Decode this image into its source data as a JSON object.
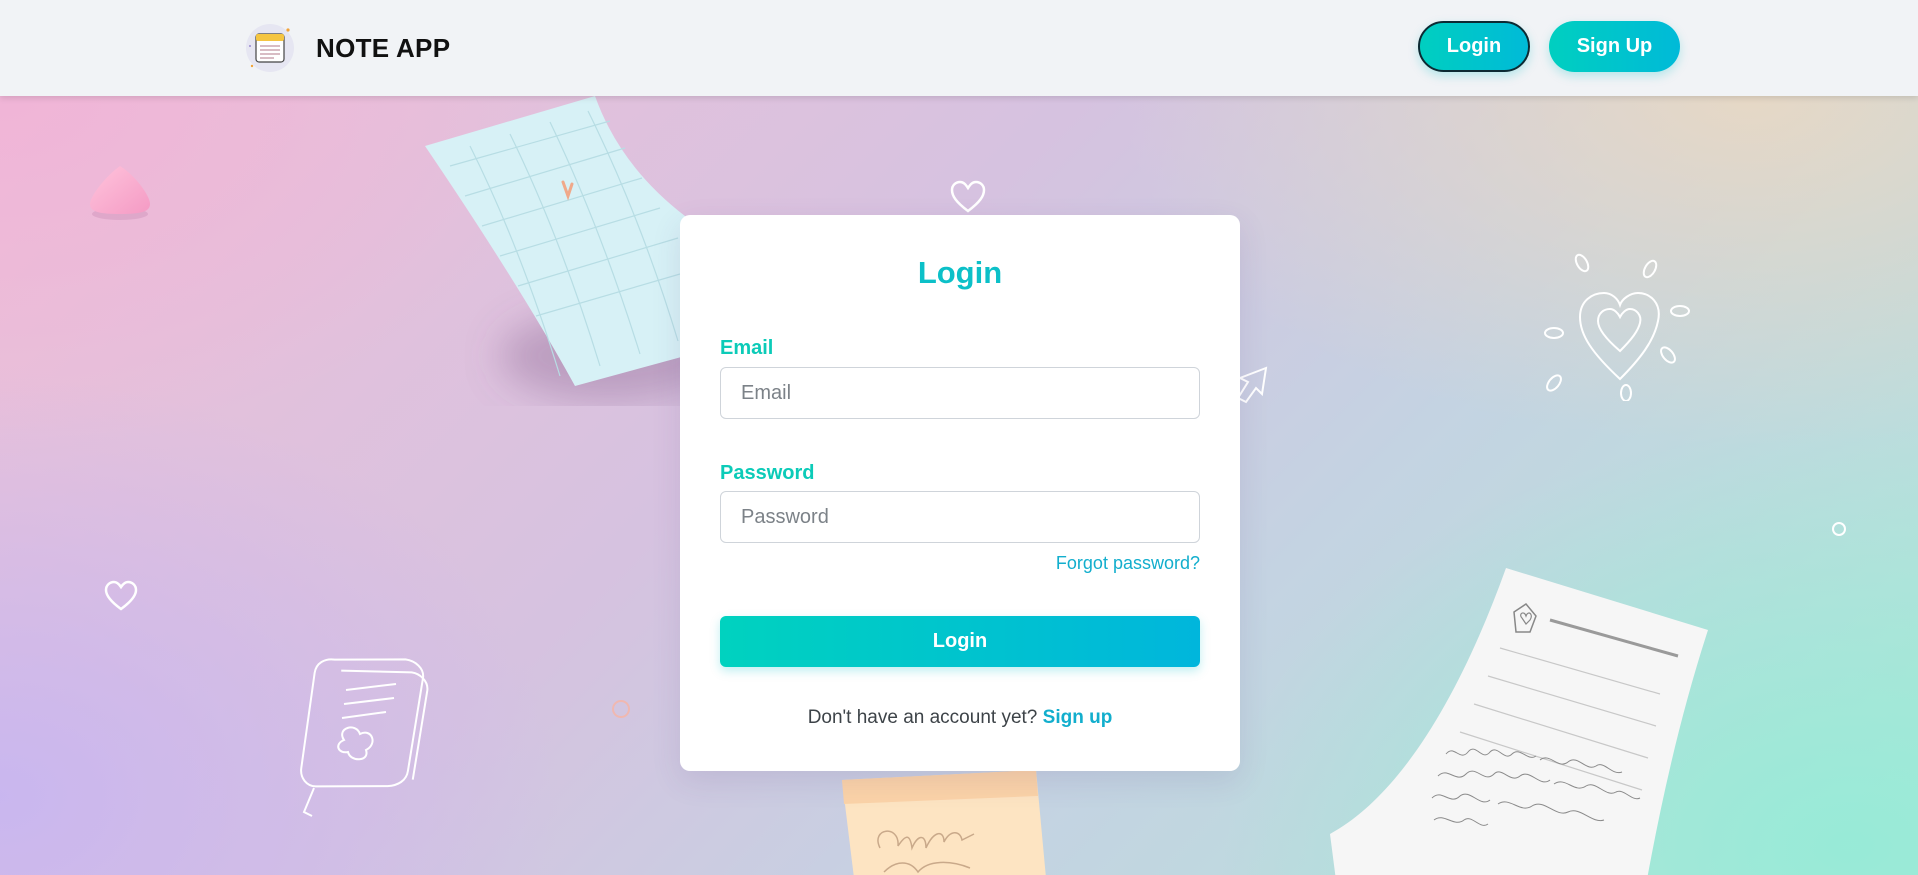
{
  "header": {
    "brand_name": "NOTE APP",
    "logo_icon": "notepad-icon",
    "login_label": "Login",
    "signup_label": "Sign Up"
  },
  "login_form": {
    "title": "Login",
    "email_label": "Email",
    "email_placeholder": "Email",
    "email_value": "",
    "password_label": "Password",
    "password_placeholder": "Password",
    "password_value": "",
    "forgot_link": "Forgot password?",
    "submit_label": "Login",
    "no_account_text": "Don't have an account yet?",
    "signup_link": "Sign up"
  },
  "colors": {
    "accent": "#00c2cc",
    "accent_gradient_start": "#00d2bf",
    "accent_gradient_end": "#00b6dc",
    "header_bg": "#f1f3f6",
    "card_bg": "#ffffff"
  },
  "decorations": [
    "pink-gem-icon",
    "grid-paper-note-icon",
    "heart-outline-icon",
    "arrow-cursor-icon",
    "heart-sparkle-icon",
    "small-heart-icon",
    "sticky-notepad-icon",
    "ring-icon",
    "sticky-note-icon",
    "handwritten-letter-icon"
  ]
}
